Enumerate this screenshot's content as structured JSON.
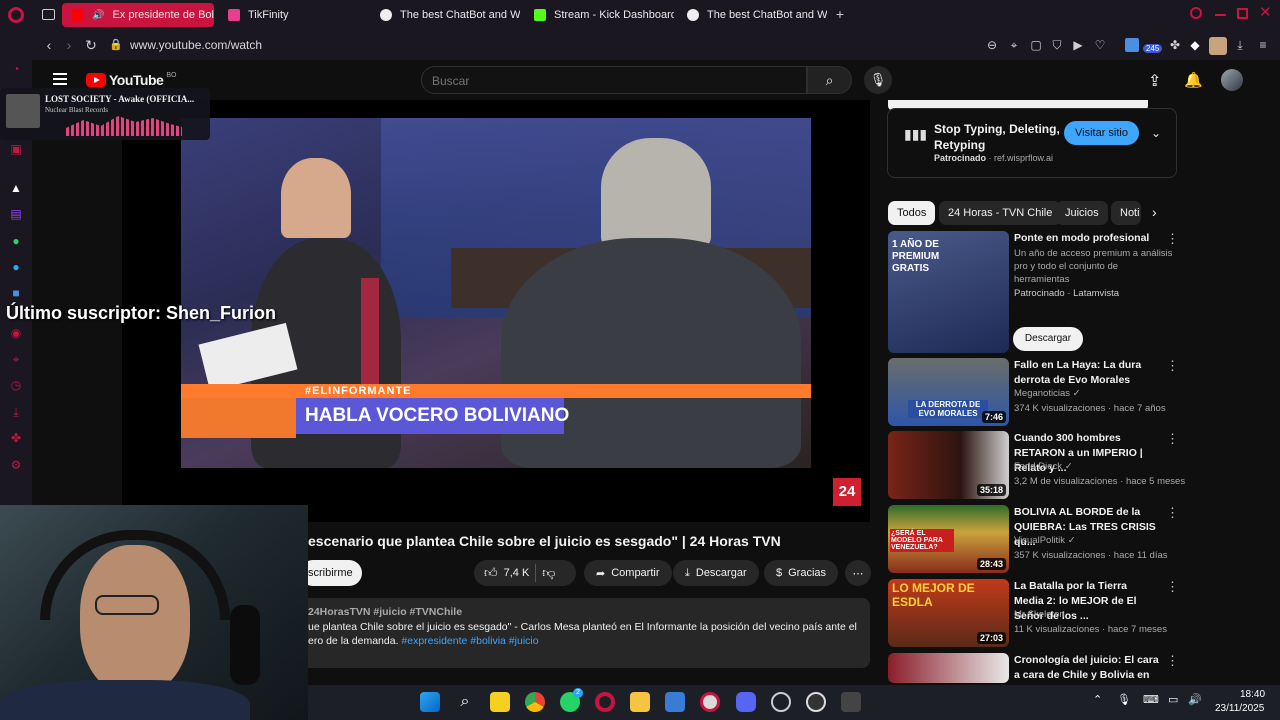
{
  "browser": {
    "tabs": [
      {
        "label": "Ex presidente de Boliv",
        "active": true
      },
      {
        "label": "TikFinity",
        "active": false
      },
      {
        "label": "The best ChatBot and Wi",
        "active": false
      },
      {
        "label": "Stream - Kick Dashboard",
        "active": false
      },
      {
        "label": "The best ChatBot and Wi",
        "active": false
      }
    ],
    "url": "www.youtube.com/watch",
    "extension_badge": "245"
  },
  "youtube": {
    "logo_text": "YouTube",
    "country_code": "BO",
    "search_placeholder": "Buscar"
  },
  "player": {
    "lower_third_tag": "#ELINFORMANTE",
    "lower_third_title": "HABLA VOCERO BOLIVIANO",
    "channel_bug": "24"
  },
  "video": {
    "title": "escenario que plantea Chile sobre el juicio es sesgado\" | 24 Horas TVN",
    "subscribe_label": "scribirme",
    "like_count": "7,4 K",
    "share_label": "Compartir",
    "download_label": "Descargar",
    "thanks_label": "Gracias",
    "description": {
      "hashtags": "24HorasTVN #juicio #TVNChile",
      "line1": "ue plantea Chile sobre el juicio es sesgado\" - Carlos Mesa planteó en El Informante la posición del vecino país ante el",
      "line2_text": "ero de la demanda. ",
      "line2_links": "#expresidente #bolivia #juicio"
    }
  },
  "ad": {
    "title_line1": "Stop Typing, Deleting,",
    "title_line2": "Retyping",
    "sponsored": "Patrocinado",
    "domain": "· ref.wisprflow.ai",
    "cta": "Visitar sitio"
  },
  "chips": [
    "Todos",
    "24 Horas - TVN Chile",
    "Juicios",
    "Noti"
  ],
  "recommendations": [
    {
      "title": "Ponte en modo profesional",
      "meta1": "Un año de acceso premium a análisis",
      "meta2": "pro y todo el conjunto de",
      "meta3": "herramientas",
      "channel": "Patrocinado · Latamvista",
      "cta": "Descargar",
      "thumb_text": "1 AÑO DE PREMIUM GRATIS"
    },
    {
      "title": "Fallo en La Haya: La dura derrota de Evo Morales",
      "channel": "Meganoticias",
      "views": "374 K visualizaciones · hace 7 años",
      "duration": "7:46",
      "thumb_text": "LA DERROTA DE EVO MORALES"
    },
    {
      "title": "Cuando 300 hombres RETARON a un IMPERIO | Relato y ...",
      "channel": "Farid Dieck",
      "views": "3,2 M de visualizaciones · hace 5 meses",
      "duration": "35:18"
    },
    {
      "title": "BOLIVIA AL BORDE de la QUIEBRA: Las TRES CRISIS qu...",
      "channel": "VisualPolitik",
      "views": "357 K visualizaciones · hace 11 días",
      "duration": "28:43",
      "thumb_text": "¿SERÁ EL MODELO PARA VENEZUELA?"
    },
    {
      "title": "La Batalla por la Tierra Media 2: lo MEJOR de El Señor de los ...",
      "channel": "Mr Skeleton",
      "views": "11 K visualizaciones · hace 7 meses",
      "duration": "27:03",
      "thumb_text": "LO MEJOR DE ESDLA"
    },
    {
      "title": "Cronología del juicio: El cara a cara de Chile y Bolivia en La ..."
    }
  ],
  "overlays": {
    "music_title": "LOST SOCIETY - Awake (OFFICIA...",
    "music_artist": "Nuclear Blast Records",
    "last_subscriber": "Último suscriptor: Shen_Furion"
  },
  "taskbar": {
    "time": "18:40",
    "date": "23/11/2025",
    "whatsapp_badge": "2"
  },
  "colors": {
    "accent_opera": "#c8143f",
    "youtube_red": "#ff0000",
    "link_blue": "#3ea6ff",
    "visit_button": "#3ea6ff"
  }
}
